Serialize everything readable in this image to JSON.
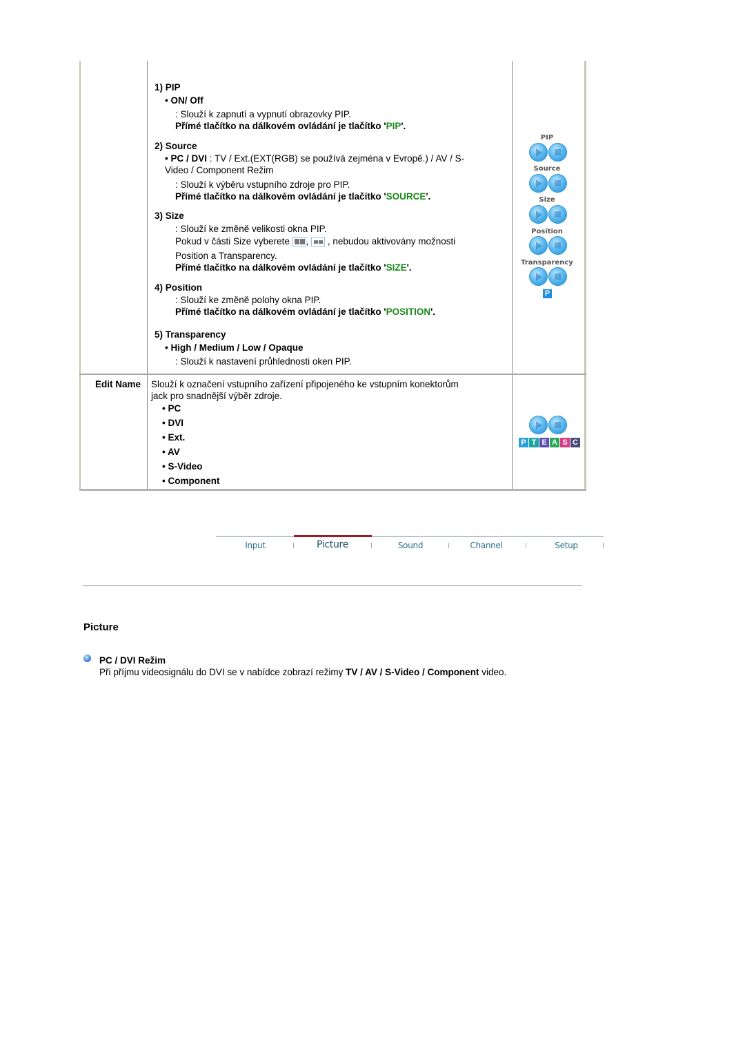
{
  "table": {
    "pip_row": {
      "items": [
        {
          "heading": "1) PIP",
          "sub": "• ON/ Off",
          "desc": ": Slouží k zapnutí a vypnutí obrazovky PIP.",
          "remote_prefix": "Přímé tlačítko na dálkovém ovládání je tlačítko '",
          "remote_key": "PIP",
          "remote_suffix": "'."
        },
        {
          "heading": "2) Source",
          "sub_bold": "• PC / DVI",
          "sub_rest": " : TV / Ext.(EXT(RGB) se používá zejména v Evropě.) / AV / S-",
          "sub_line2": "Video / Component Režim",
          "desc": ": Slouží k výběru vstupního zdroje pro PIP.",
          "remote_prefix": "Přímé tlačítko na dálkovém ovládání je tlačítko '",
          "remote_key": "SOURCE",
          "remote_suffix": "'."
        },
        {
          "heading": "3) Size",
          "desc": ": Slouží ke změně velikosti okna PIP.",
          "desc2_a": "Pokud v části Size vyberete ",
          "desc2_sep": ",",
          "desc2_b": " , nebudou aktivovány možnosti",
          "desc3": "Position a Transparency.",
          "remote_prefix": "Přímé tlačítko na dálkovém ovládání je tlačítko '",
          "remote_key": "SIZE",
          "remote_suffix": "'."
        },
        {
          "heading": "4) Position",
          "desc": ": Slouží ke změně polohy okna PIP.",
          "remote_prefix": "Přímé tlačítko na dálkovém ovládání je tlačítko '",
          "remote_key": "POSITION",
          "remote_suffix": "'."
        },
        {
          "heading": "5) Transparency",
          "sub": "• High / Medium / Low / Opaque",
          "desc": ": Slouží k nastavení průhlednosti oken PIP."
        }
      ],
      "side_labels": [
        "PIP",
        "Source",
        "Size",
        "Position",
        "Transparency"
      ],
      "side_badge": "P"
    },
    "edit_name_row": {
      "label": "Edit Name",
      "desc_line1": "Slouží k označení vstupního zařízení připojeného ke vstupním konektorům",
      "desc_line2": "jack pro snadnější výběr zdroje.",
      "options": [
        "• PC",
        "• DVI",
        "• Ext.",
        "• AV",
        "• S-Video",
        "• Component"
      ],
      "side_letters": [
        {
          "letter": "P",
          "color": "#2aa0d8"
        },
        {
          "letter": "T",
          "color": "#1fa6a0"
        },
        {
          "letter": "E",
          "color": "#5a4fb0"
        },
        {
          "letter": "A",
          "color": "#2aa85a"
        },
        {
          "letter": "S",
          "color": "#d83f8a"
        },
        {
          "letter": "C",
          "color": "#4a4a7a"
        }
      ]
    }
  },
  "nav": {
    "items": [
      "Input",
      "Picture",
      "Sound",
      "Channel",
      "Setup"
    ],
    "active": "Picture",
    "active_color": "#a01c24"
  },
  "section": {
    "title": "Picture",
    "item_title": "PC / DVI Režim",
    "text_a": "Při příjmu videosignálu do DVI se v nabídce zobrazí režimy ",
    "text_bold": "TV / AV / S-Video / Component",
    "text_b": " video."
  },
  "colors": {
    "remote_key": "#1a8a1a"
  }
}
